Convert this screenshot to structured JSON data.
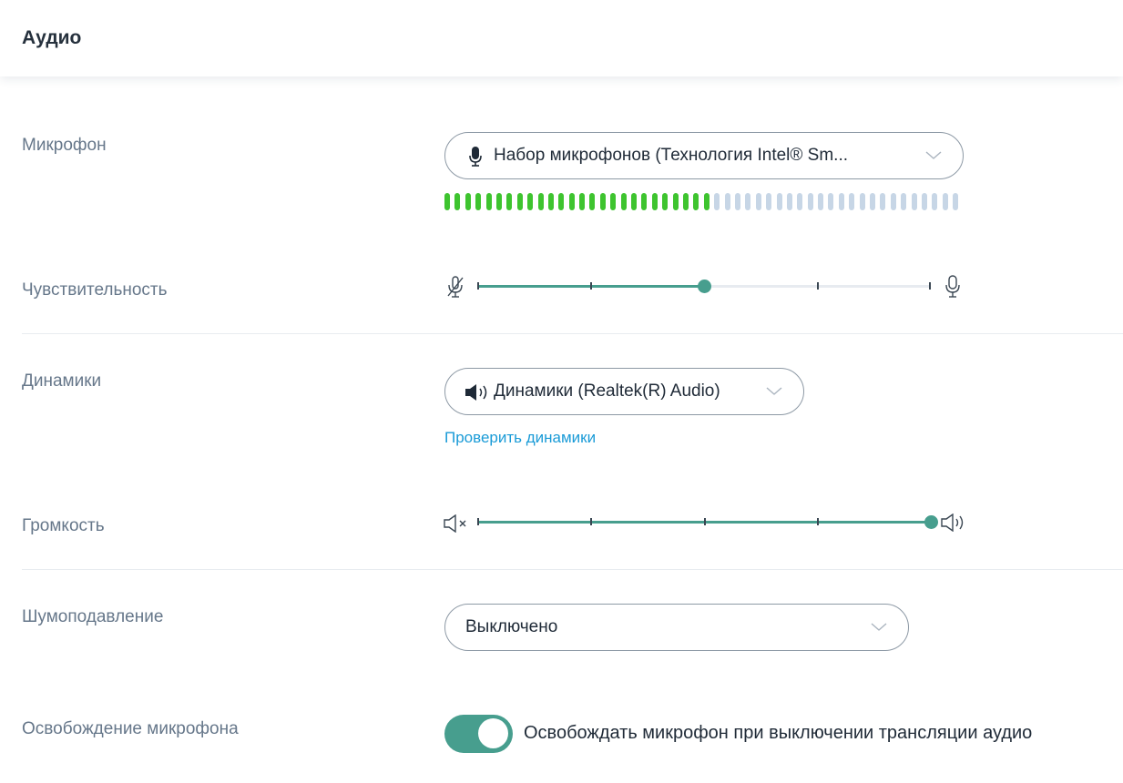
{
  "header": {
    "title": "Аудио"
  },
  "microphone": {
    "label": "Микрофон",
    "device": "Набор микрофонов (Технология Intel® Sm...",
    "icon": "microphone-icon",
    "level": {
      "segments_total": 50,
      "segments_active": 26
    },
    "colors": {
      "active": "#3ec42f",
      "inactive": "#c7d6e6"
    }
  },
  "sensitivity": {
    "label": "Чувствительность",
    "value_percent": 50,
    "min_icon": "microphone-muted-icon",
    "max_icon": "microphone-icon"
  },
  "speakers": {
    "label": "Динамики",
    "device": "Динамики (Realtek(R) Audio)",
    "icon": "speaker-icon",
    "test_link": "Проверить динамики"
  },
  "volume": {
    "label": "Громкость",
    "value_percent": 100,
    "min_icon": "speaker-muted-icon",
    "max_icon": "speaker-loud-icon"
  },
  "noise": {
    "label": "Шумоподавление",
    "value": "Выключено"
  },
  "release": {
    "label": "Освобождение микрофона",
    "toggle_on": true,
    "toggle_text": "Освобождать микрофон при выключении трансляции аудио"
  },
  "colors": {
    "accent": "#479e8e",
    "link": "#1a9bd7"
  }
}
